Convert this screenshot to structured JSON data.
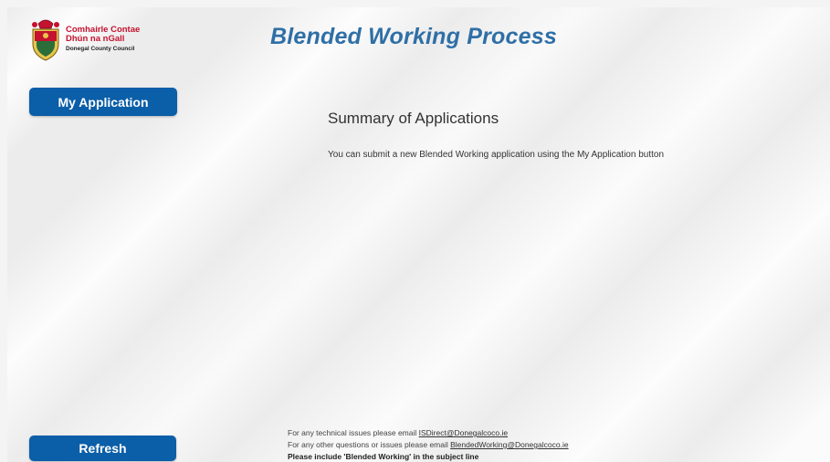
{
  "header": {
    "logo": {
      "line1": "Comhairle Contae",
      "line2": "Dhún na nGall",
      "line3": "Donegal County Council"
    },
    "title": "Blended Working Process"
  },
  "sidebar": {
    "my_application_label": "My Application",
    "refresh_label": "Refresh"
  },
  "main": {
    "summary_title": "Summary of Applications",
    "summary_text": "You can submit a new Blended Working application using the My Application button"
  },
  "footer": {
    "technical_prefix": "For any technical issues please email ",
    "technical_email": "ISDirect@Donegalcoco.ie",
    "other_prefix": "For any other questions or issues please email ",
    "other_email": "BlendedWorking@Donegalcoco.ie",
    "subject_note": "Please include 'Blended Working' in the subject line"
  },
  "colors": {
    "brand_blue": "#0b5ea8",
    "title_blue": "#2f6fa6",
    "logo_red": "#c4122f"
  }
}
